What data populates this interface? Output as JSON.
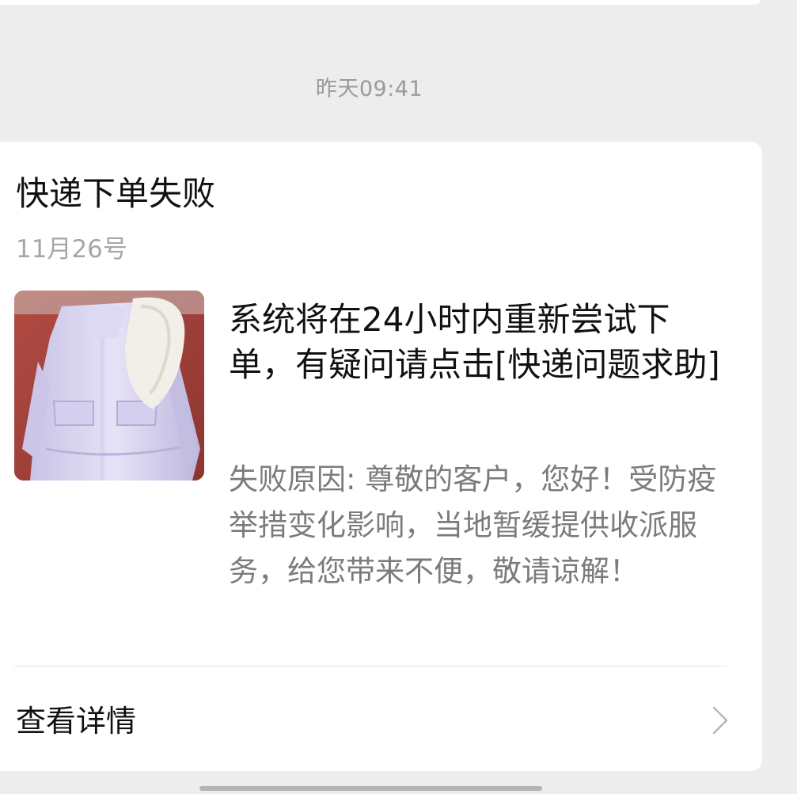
{
  "timestamp": "昨天09:41",
  "card": {
    "title": "快递下单失败",
    "date": "11月26号",
    "thumbnail_alt": "jacket-photo",
    "message_title": "系统将在24小时内重新尝试下单，有疑问请点击[快递问题求助]",
    "message_desc": "失败原因: 尊敬的客户，您好！受防疫举措变化影响，当地暂缓提供收派服务，给您带来不便，敬请谅解！",
    "detail_label": "查看详情"
  },
  "colors": {
    "background": "#ededed",
    "card": "#ffffff",
    "title_text": "#111111",
    "secondary_text": "#7b7b7b",
    "muted_text": "#a6a6a6"
  }
}
